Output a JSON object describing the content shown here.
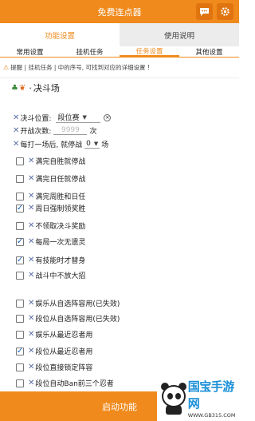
{
  "app": {
    "title": "免费连点器"
  },
  "main_tabs": [
    {
      "label": "功能设置",
      "active": true
    },
    {
      "label": "使用说明",
      "active": false
    }
  ],
  "sub_tabs": [
    {
      "label": "常用设置",
      "active": false
    },
    {
      "label": "挂机任务",
      "active": false
    },
    {
      "label": "任务设置",
      "active": true
    },
    {
      "label": "其他设置",
      "active": false
    }
  ],
  "hint": {
    "icon": "warning-icon",
    "text": "提醒 | 挂机任务 | 中的序号, 可找到对应的详细设置 !"
  },
  "section": {
    "title": "决斗场"
  },
  "duel": {
    "position_label": "决斗位置:",
    "position_value": "段位赛",
    "count_label": "开战次数:",
    "count_placeholder": "9999",
    "count_unit": "次",
    "pause_label": "每打一场后, 就停战",
    "pause_value": "0",
    "pause_unit": "场"
  },
  "options": [
    {
      "label": "满完自胜就停战",
      "checked": false
    },
    {
      "label": "满完日任就停战",
      "checked": false
    },
    {
      "label": "满完周胜和日任",
      "checked": false
    },
    {
      "label": "周日强制领奖胜",
      "checked": true
    },
    {
      "label": "不领取决斗奖励",
      "checked": false
    },
    {
      "label": "每局一次无遗灵",
      "checked": true
    },
    {
      "label": "有技能时才替身",
      "checked": true
    },
    {
      "label": "战斗中不放大招",
      "checked": false
    },
    {
      "label": "娱乐从自选阵容用(已失效)",
      "checked": false
    },
    {
      "label": "段位从自选阵容用(已失效)",
      "checked": false
    },
    {
      "label": "娱乐从最近忍者用",
      "checked": false
    },
    {
      "label": "段位从最近忍者用",
      "checked": true
    },
    {
      "label": "段位直接锁定阵容",
      "checked": false
    },
    {
      "label": "段位自动Ban前三个忍者",
      "checked": false
    }
  ],
  "start_button": {
    "label": "启动功能"
  },
  "watermark": {
    "brand": "国宝手游网",
    "url": "WWW.GB315.COM"
  },
  "colors": {
    "accent": "#f08a1c",
    "check": "#1565c0"
  }
}
